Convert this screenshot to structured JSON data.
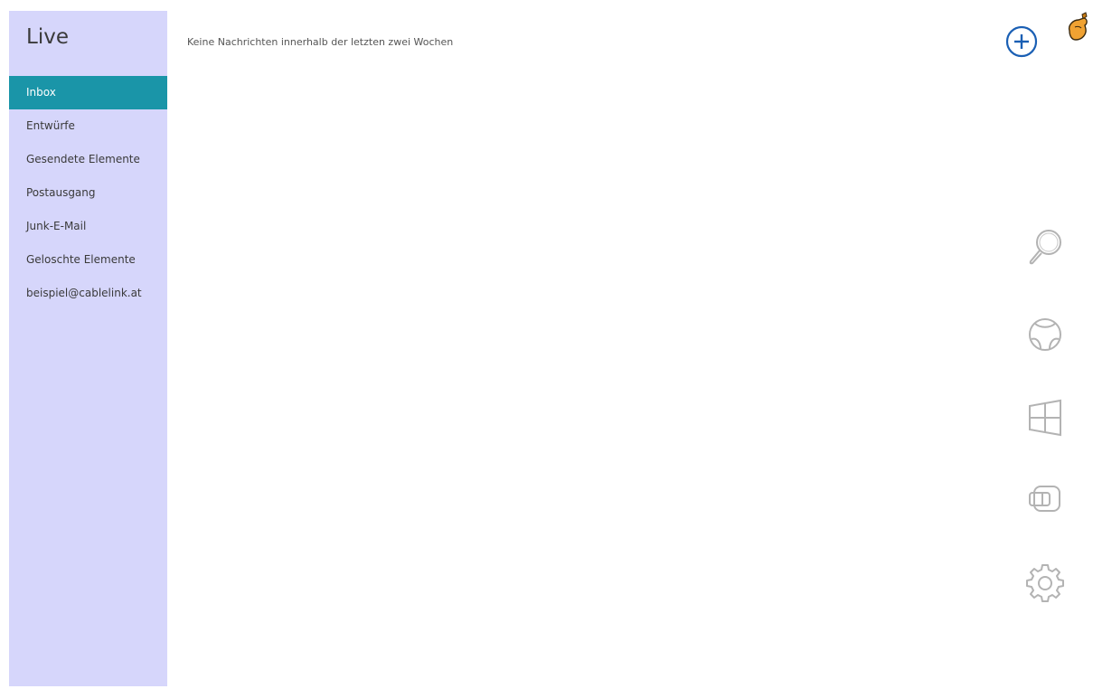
{
  "sidebar": {
    "title": "Live",
    "folders": [
      {
        "label": "Inbox",
        "selected": true
      },
      {
        "label": "Entwürfe",
        "selected": false
      },
      {
        "label": "Gesendete Elemente",
        "selected": false
      },
      {
        "label": "Postausgang",
        "selected": false
      },
      {
        "label": "Junk-E-Mail",
        "selected": false
      },
      {
        "label": "Geloschte Elemente",
        "selected": false
      },
      {
        "label": "beispiel@cablelink.at",
        "selected": false
      }
    ]
  },
  "main": {
    "empty_message": "Keine Nachrichten innerhalb der letzten zwei Wochen"
  },
  "toolbar": {
    "new_message_icon": "plus-circle-icon"
  },
  "charms": [
    {
      "icon": "search-icon"
    },
    {
      "icon": "share-icon"
    },
    {
      "icon": "windows-start-icon"
    },
    {
      "icon": "devices-icon"
    },
    {
      "icon": "settings-gear-icon"
    }
  ],
  "colors": {
    "sidebar_bg": "#d6d6fb",
    "selected_bg": "#1a95a8",
    "accent": "#1a5fb4"
  }
}
